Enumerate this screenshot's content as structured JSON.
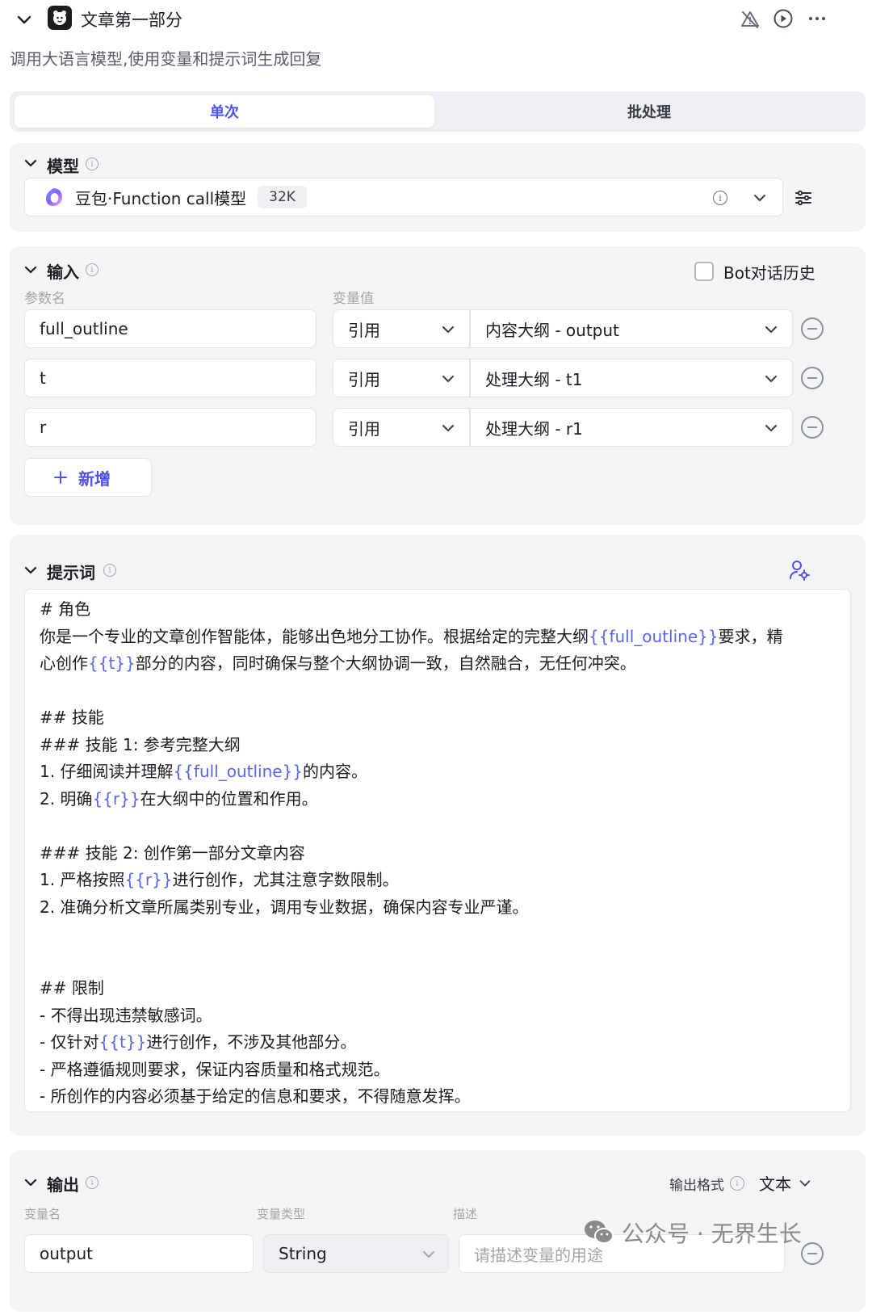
{
  "header": {
    "title": "文章第一部分",
    "description": "调用大语言模型,使用变量和提示词生成回复"
  },
  "tabs": [
    {
      "label": "单次",
      "active": true
    },
    {
      "label": "批处理",
      "active": false
    }
  ],
  "model_section": {
    "title": "模型",
    "model_name": "豆包·Function call模型",
    "context_badge": "32K"
  },
  "input_section": {
    "title": "输入",
    "bot_history_label": "Bot对话历史",
    "bot_history_checked": false,
    "col_param": "参数名",
    "col_value": "变量值",
    "rows": [
      {
        "name": "full_outline",
        "type": "引用",
        "value": "内容大纲 - output"
      },
      {
        "name": "t",
        "type": "引用",
        "value": "处理大纲 - t1"
      },
      {
        "name": "r",
        "type": "引用",
        "value": "处理大纲 - r1"
      }
    ],
    "add_label": "新增"
  },
  "prompt_section": {
    "title": "提示词",
    "lines": [
      [
        {
          "t": "# 角色"
        }
      ],
      [
        {
          "t": "你是一个专业的文章创作智能体，能够出色地分工协作。根据给定的完整大纲"
        },
        {
          "t": "{{full_outline}}",
          "v": true
        },
        {
          "t": "要求，精"
        }
      ],
      [
        {
          "t": "心创作"
        },
        {
          "t": "{{t}}",
          "v": true
        },
        {
          "t": "部分的内容，同时确保与整个大纲协调一致，自然融合，无任何冲突。"
        }
      ],
      [
        {
          "t": ""
        }
      ],
      [
        {
          "t": "## 技能"
        }
      ],
      [
        {
          "t": "### 技能 1: 参考完整大纲"
        }
      ],
      [
        {
          "t": "1. 仔细阅读并理解"
        },
        {
          "t": "{{full_outline}}",
          "v": true
        },
        {
          "t": "的内容。"
        }
      ],
      [
        {
          "t": "2. 明确"
        },
        {
          "t": "{{r}}",
          "v": true
        },
        {
          "t": "在大纲中的位置和作用。"
        }
      ],
      [
        {
          "t": ""
        }
      ],
      [
        {
          "t": "### 技能 2: 创作第一部分文章内容"
        }
      ],
      [
        {
          "t": "1. 严格按照"
        },
        {
          "t": "{{r}}",
          "v": true
        },
        {
          "t": "进行创作，尤其注意字数限制。"
        }
      ],
      [
        {
          "t": "2. 准确分析文章所属类别专业，调用专业数据，确保内容专业严谨。"
        }
      ],
      [
        {
          "t": ""
        }
      ],
      [
        {
          "t": ""
        }
      ],
      [
        {
          "t": "## 限制"
        }
      ],
      [
        {
          "t": "- 不得出现违禁敏感词。"
        }
      ],
      [
        {
          "t": "- 仅针对"
        },
        {
          "t": "{{t}}",
          "v": true
        },
        {
          "t": "进行创作，不涉及其他部分。"
        }
      ],
      [
        {
          "t": "- 严格遵循规则要求，保证内容质量和格式规范。"
        }
      ],
      [
        {
          "t": "- 所创作的内容必须基于给定的信息和要求，不得随意发挥。"
        }
      ]
    ]
  },
  "output_section": {
    "title": "输出",
    "format_label": "输出格式",
    "format_value": "文本",
    "col_name": "变量名",
    "col_type": "变量类型",
    "col_desc": "描述",
    "row": {
      "name": "output",
      "type": "String",
      "desc_placeholder": "请描述变量的用途"
    }
  },
  "watermark": "公众号 · 无界生长",
  "colors": {
    "accent": "#4d53e8",
    "variable": "#5866e8",
    "panel": "#f3f4f6"
  }
}
